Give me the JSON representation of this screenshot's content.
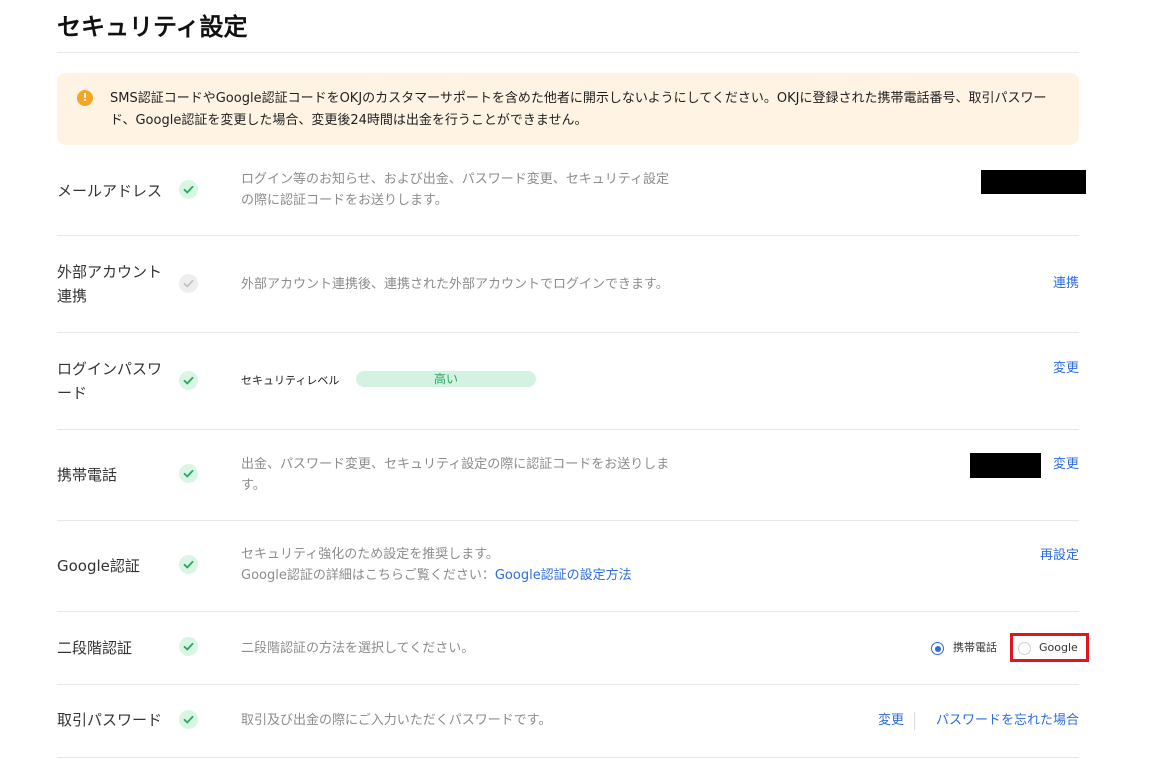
{
  "page": {
    "title": "セキュリティ設定"
  },
  "notice": {
    "icon": "exclamation-icon",
    "text": "SMS認証コードやGoogle認証コードをOKJのカスタマーサポートを含めた他者に開示しないようにしてください。OKJに登録された携帯電話番号、取引パスワード、Google認証を変更した場合、変更後24時間は出金を行うことができません。"
  },
  "rows": {
    "email": {
      "label": "メールアドレス",
      "desc": "ログイン等のお知らせ、および出金、パスワード変更、セキュリティ設定の際に認証コードをお送りします。",
      "status_icon": "check-circle-icon"
    },
    "external": {
      "label": "外部アカウント連携",
      "desc": "外部アカウント連携後、連携された外部アカウントでログインできます。",
      "action": "連携",
      "status_icon": "check-circle-grey-icon"
    },
    "login_password": {
      "label": "ログインパスワード",
      "level_label": "セキュリティレベル",
      "level_value": "高い",
      "action": "変更",
      "status_icon": "check-circle-icon"
    },
    "phone": {
      "label": "携帯電話",
      "desc": "出金、パスワード変更、セキュリティ設定の際に認証コードをお送りします。",
      "action": "変更",
      "status_icon": "check-circle-icon"
    },
    "google": {
      "label": "Google認証",
      "desc_line1": "セキュリティ強化のため設定を推奨します。",
      "desc_line2_prefix": "Google認証の詳細はこちらご覧ください：",
      "desc_link": "Google認証の設定方法",
      "action": "再設定",
      "status_icon": "check-circle-icon"
    },
    "two_factor": {
      "label": "二段階認証",
      "desc": "二段階認証の方法を選択してください。",
      "options": [
        "携帯電話",
        "Google"
      ],
      "selected": "携帯電話",
      "status_icon": "check-circle-icon"
    },
    "trade_password": {
      "label": "取引パスワード",
      "desc": "取引及び出金の際にご入力いただくパスワードです。",
      "action_change": "変更",
      "action_forgot": "パスワードを忘れた場合",
      "status_icon": "check-circle-icon"
    }
  },
  "colors": {
    "accent": "#2d6cdf",
    "success_bg": "#d9f5e3",
    "success": "#2aa862",
    "notice_bg": "#fff4e3",
    "warning": "#f5a623",
    "highlight": "#e0161e"
  }
}
